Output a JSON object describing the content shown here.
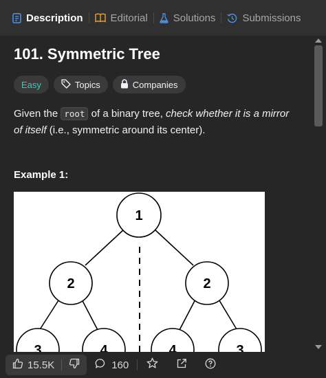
{
  "tabs": [
    {
      "label": "Description",
      "icon": "description-icon",
      "active": true
    },
    {
      "label": "Editorial",
      "icon": "book-icon",
      "active": false
    },
    {
      "label": "Solutions",
      "icon": "flask-icon",
      "active": false
    },
    {
      "label": "Submissions",
      "icon": "history-icon",
      "active": false
    }
  ],
  "problem": {
    "title": "101. Symmetric Tree",
    "difficulty": "Easy",
    "topics_label": "Topics",
    "companies_label": "Companies",
    "desc_before": "Given the ",
    "desc_code": "root",
    "desc_mid": " of a binary tree, ",
    "desc_italic": "check whether it is a mirror of itself",
    "desc_after": " (i.e., symmetric around its center).",
    "example_label": "Example 1:"
  },
  "tree_nodes": {
    "root": "1",
    "left": "2",
    "right": "2",
    "ll": "3",
    "lr": "4",
    "rl": "4",
    "rr": "3"
  },
  "footer": {
    "likes": "15.5K",
    "comments": "160"
  },
  "colors": {
    "accent_easy": "#46c6c2",
    "tab_active_icon": "#4a90e2",
    "bg": "#262626"
  }
}
